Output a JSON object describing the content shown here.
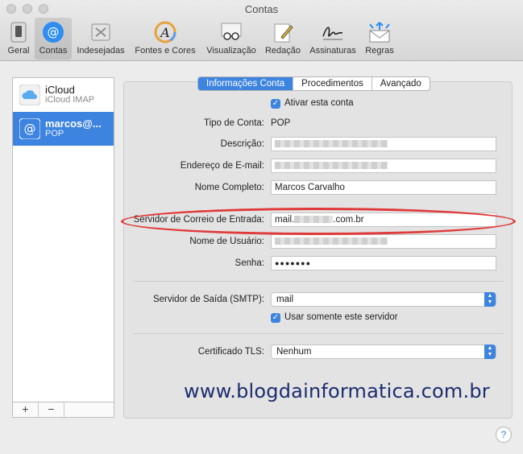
{
  "window": {
    "title": "Contas"
  },
  "toolbar": {
    "items": [
      {
        "label": "Geral"
      },
      {
        "label": "Contas"
      },
      {
        "label": "Indesejadas"
      },
      {
        "label": "Fontes e Cores"
      },
      {
        "label": "Visualização"
      },
      {
        "label": "Redação"
      },
      {
        "label": "Assinaturas"
      },
      {
        "label": "Regras"
      }
    ],
    "selected": "Contas"
  },
  "sidebar": {
    "accounts": [
      {
        "name": "iCloud",
        "type": "iCloud IMAP",
        "icon": "cloud-icon"
      },
      {
        "name": "marcos@...",
        "type": "POP",
        "icon": "at-icon"
      }
    ],
    "add_label": "+",
    "remove_label": "−"
  },
  "tabs": [
    {
      "label": "Informações Conta"
    },
    {
      "label": "Procedimentos"
    },
    {
      "label": "Avançado"
    }
  ],
  "form": {
    "enable_account": "Ativar esta conta",
    "account_type_label": "Tipo de Conta:",
    "account_type_value": "POP",
    "description_label": "Descrição:",
    "email_label": "Endereço de E-mail:",
    "fullname_label": "Nome Completo:",
    "fullname_value": "Marcos Carvalho",
    "incoming_label": "Servidor de Correio de Entrada:",
    "incoming_prefix": "mail.",
    "incoming_suffix": ".com.br",
    "username_label": "Nome de Usuário:",
    "password_label": "Senha:",
    "password_value": "●●●●●●●",
    "smtp_label": "Servidor de Saída (SMTP):",
    "smtp_value": "mail",
    "only_server": "Usar somente este servidor",
    "tls_label": "Certificado TLS:",
    "tls_value": "Nenhum"
  },
  "watermark": "www.blogdainformatica.com.br",
  "help": "?",
  "colors": {
    "accent": "#3d83e0",
    "highlight": "#e03a3a",
    "watermark": "#1c2d6e"
  }
}
